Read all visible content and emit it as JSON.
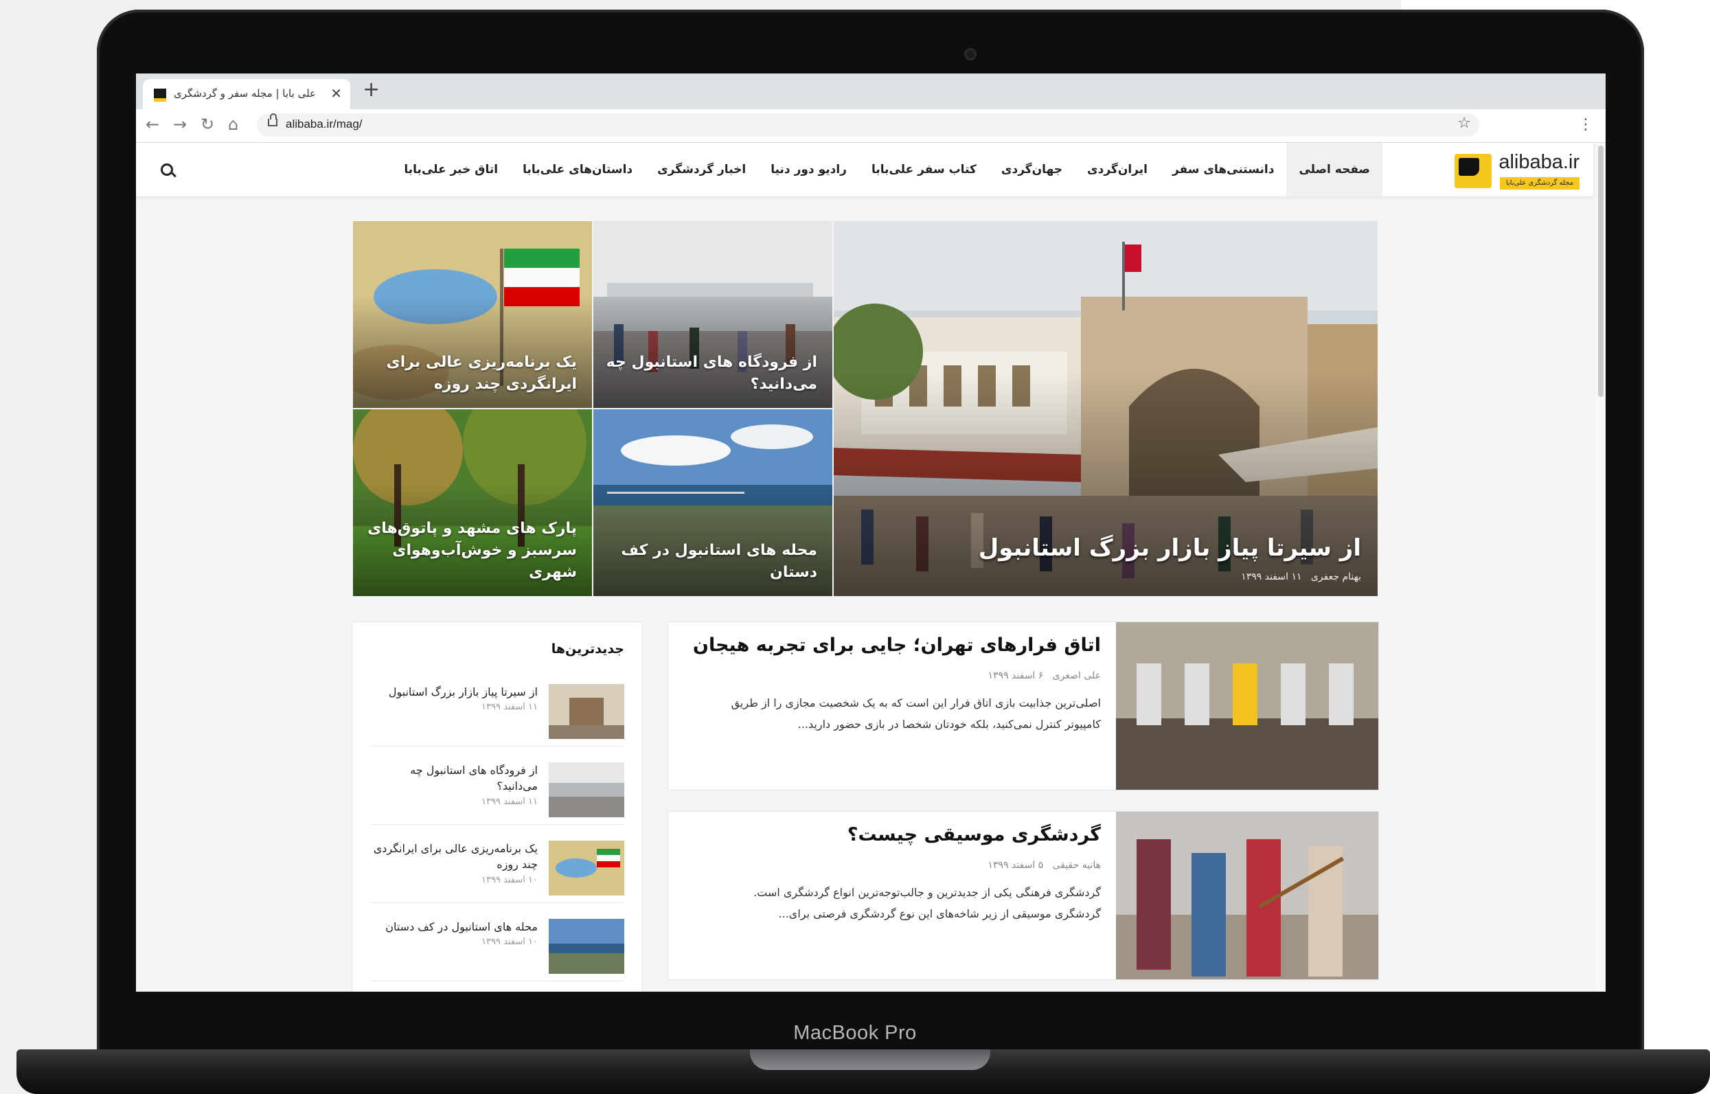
{
  "device": {
    "model": "MacBook Pro"
  },
  "browser": {
    "tab_title": "علی بابا | مجله سفر و گردشگری",
    "new_tab": "+",
    "close": "✕",
    "url": "alibaba.ir/mag/",
    "icons": [
      "back-icon",
      "forward-icon",
      "reload-icon",
      "home-icon",
      "lock-icon",
      "star-icon",
      "menu-icon"
    ]
  },
  "site": {
    "logo_text": "alibaba.ir",
    "logo_subtitle": "مجله گردشگری علی‌بابا",
    "nav": [
      "صفحه اصلی",
      "دانستنی‌های سفر",
      "ایران‌گردی",
      "جهان‌گردی",
      "کتاب سفر علی‌بابا",
      "رادیو دور دنیا",
      "اخبار گردشگری",
      "داستان‌های علی‌بابا",
      "اتاق خبر علی‌بابا"
    ]
  },
  "hero": {
    "main": {
      "title": "از سیرتا پیاز بازار بزرگ استانبول",
      "author": "بهنام جعفری",
      "date": "۱۱ اسفند ۱۳۹۹"
    },
    "tiles": [
      "از فرودگاه های استانبول چه می‌دانید؟",
      "یک برنامه‌ریزی عالی برای ایرانگردی چند روزه",
      "محله های استانبول در کف دستان",
      "پارک های مشهد و پاتوق‌های سرسبز و خوش‌آب‌وهوای شهری"
    ]
  },
  "articles": [
    {
      "title": "اتاق فرارهای تهران؛ جایی برای تجربه هیجان",
      "author": "علی اصغری",
      "date": "۶ اسفند ۱۳۹۹",
      "excerpt": "اصلی‌ترین جذابیت بازی اتاق فرار این است که به یک شخصیت مجازی را از طریق کامپیوتر کنترل نمی‌کنید، بلکه خودتان شخصا در بازی حضور دارید..."
    },
    {
      "title": "گردشگری موسیقی چیست؟",
      "author": "هانیه حقیقی",
      "date": "۵ اسفند ۱۳۹۹",
      "excerpt": "گردشگری فرهنگی یکی از جدیدترین و جالب‌توجه‌ترین انواع گردشگری است. گردشگری موسیقی از زیر شاخه‌های این نوع گردشگری فرصتی برای..."
    }
  ],
  "sidebar": {
    "title": "جدیدترین‌ها",
    "items": [
      {
        "title": "از سیرتا پیاز بازار بزرگ استانبول",
        "date": "۱۱ اسفند ۱۳۹۹"
      },
      {
        "title": "از فرودگاه های استانبول چه می‌دانید؟",
        "date": "۱۱ اسفند ۱۳۹۹"
      },
      {
        "title": "یک برنامه‌ریزی عالی برای ایرانگردی چند روزه",
        "date": "۱۰ اسفند ۱۳۹۹"
      },
      {
        "title": "محله های استانبول در کف دستان",
        "date": "۱۰ اسفند ۱۳۹۹"
      }
    ]
  },
  "colors": {
    "brand_yellow": "#f5c81e",
    "frame": "#0e0e0f",
    "page_bg": "#f4f4f4"
  }
}
